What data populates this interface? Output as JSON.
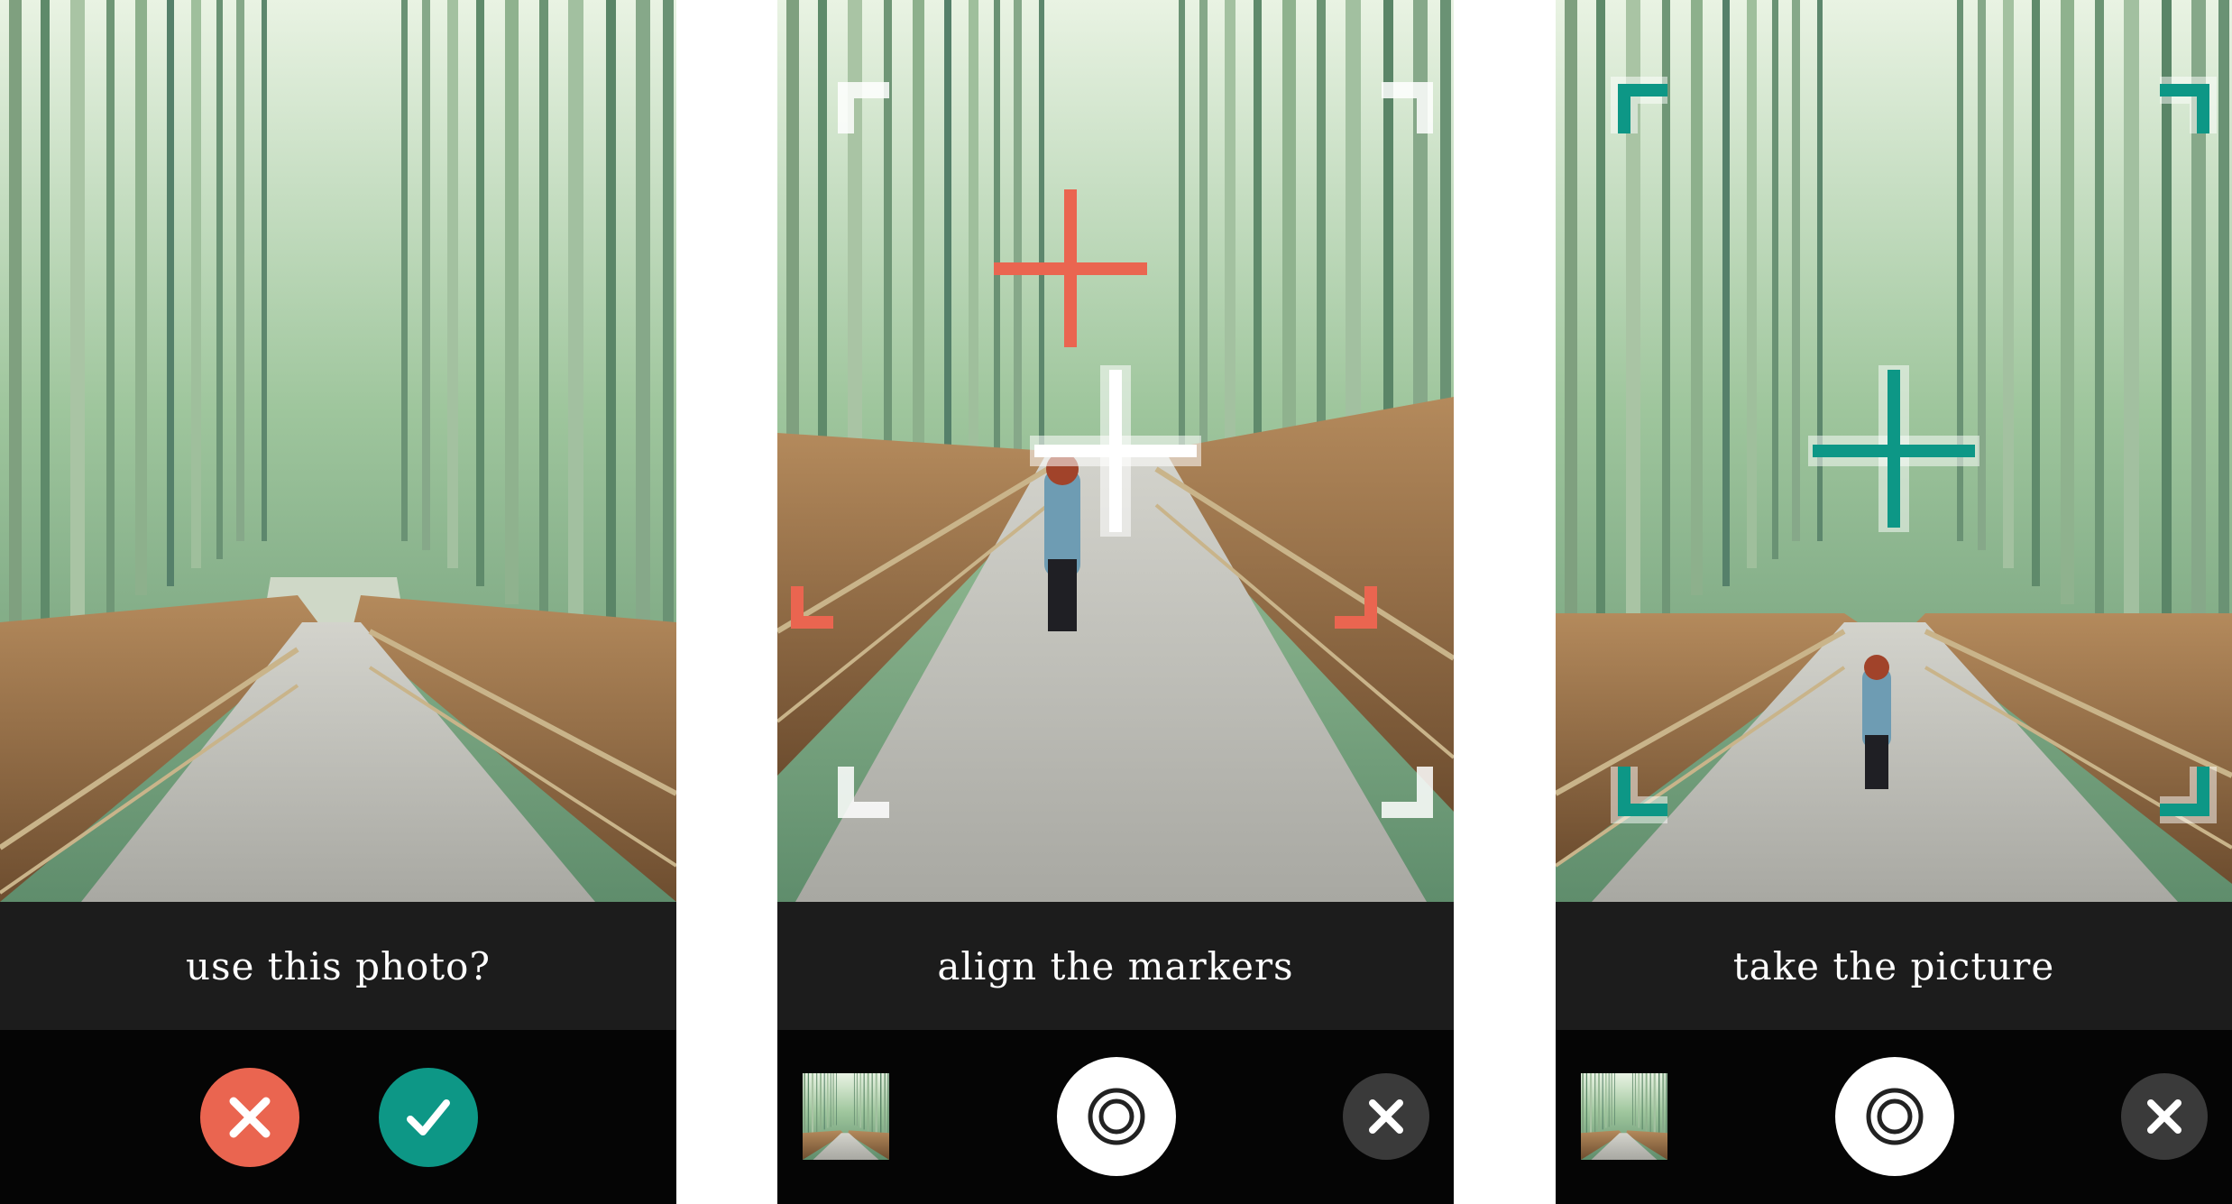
{
  "screens": [
    {
      "caption": "use this photo?"
    },
    {
      "caption": "align the markers"
    },
    {
      "caption": "take the picture"
    }
  ],
  "icons": {
    "reject": "x-icon",
    "accept": "checkmark-icon",
    "shutter": "shutter-icon",
    "close": "close-icon",
    "thumbnail": "photo-thumbnail-icon",
    "target": "crosshair-icon",
    "corner": "corner-marker-icon"
  },
  "colors": {
    "coral": "#ea6550",
    "teal": "#0d9786",
    "caption_bar": "#1c1c1c",
    "control_bar": "#050505"
  }
}
